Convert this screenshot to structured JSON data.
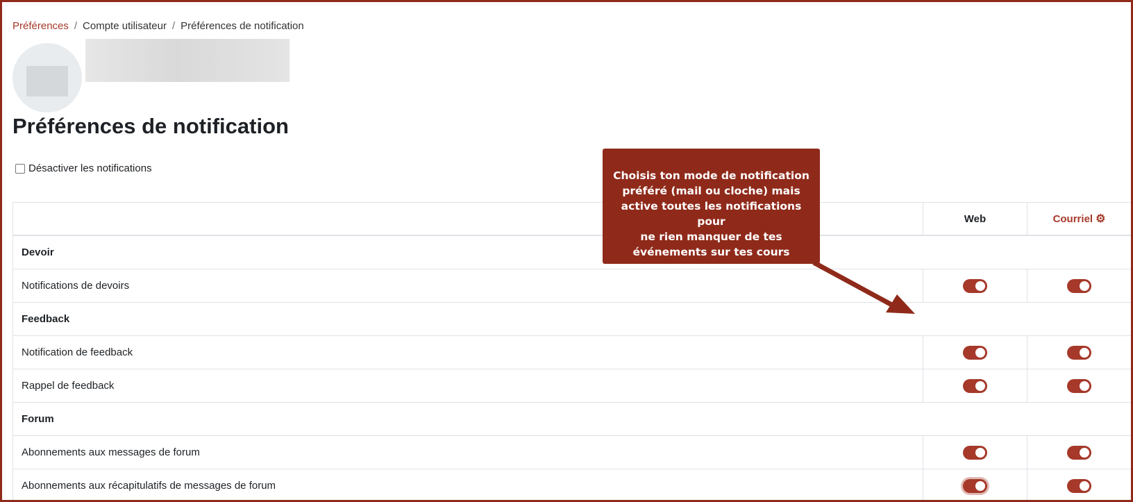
{
  "breadcrumb": {
    "link": "Préférences",
    "separator": "/",
    "item2": "Compte utilisateur",
    "item3": "Préférences de notification"
  },
  "page_title": "Préférences de notification",
  "disable_label": "Désactiver les notifications",
  "table": {
    "col_web": "Web",
    "col_email": "Courriel",
    "groups": [
      {
        "name": "Devoir",
        "rows": [
          "Notifications de devoirs"
        ]
      },
      {
        "name": "Feedback",
        "rows": [
          "Notification de feedback",
          "Rappel de feedback"
        ]
      },
      {
        "name": "Forum",
        "rows": [
          "Abonnements aux messages de forum",
          "Abonnements aux récapitulatifs de messages de forum"
        ]
      }
    ]
  },
  "callout": {
    "line1": "Choisis ton mode de notification",
    "line2": "préféré (mail ou cloche) mais",
    "line3": "active toutes les notifications pour",
    "line4": "ne rien manquer de tes",
    "line5": "événements sur tes cours"
  },
  "colors": {
    "accent": "#a6392a",
    "callout_bg": "#8f2a1a"
  },
  "icons": {
    "email_settings": "gear-icon"
  }
}
